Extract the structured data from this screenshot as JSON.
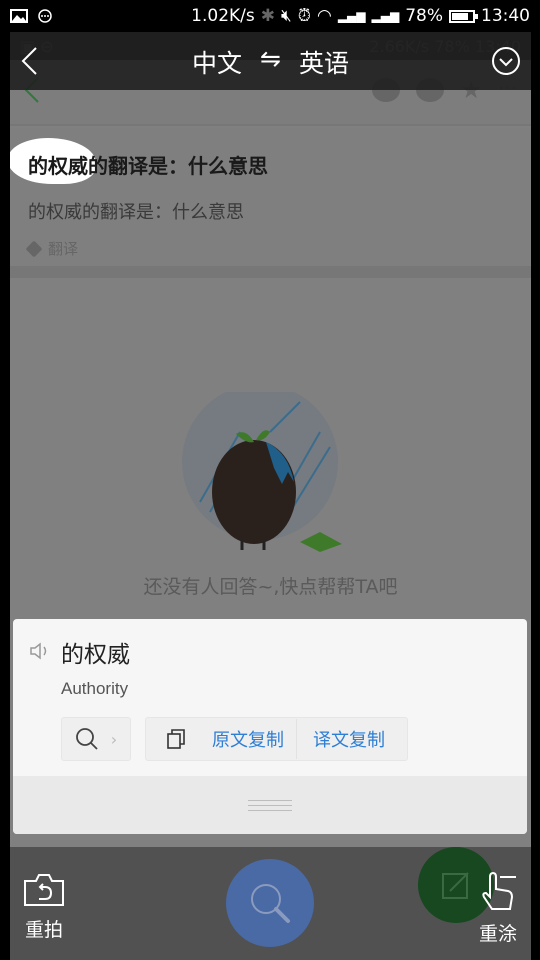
{
  "status_bar": {
    "net_speed": "1.02K/s",
    "battery": "78%",
    "battery_level": 0.78,
    "time": "13:40",
    "icons": [
      "image-icon",
      "message-icon",
      "bluetooth-icon",
      "mute-icon",
      "alarm-icon",
      "wifi-icon",
      "signal-icon",
      "signal-icon",
      "battery-icon"
    ]
  },
  "background_screen": {
    "status_net_speed": "2.66K/s",
    "status_battery": "78%",
    "status_time": "13:40",
    "question_title": "的权威的翻译是：什么意思",
    "question_body": "的权威的翻译是：什么意思",
    "tag": "翻译",
    "empty_text": "还没有人回答~,快点帮帮TA吧"
  },
  "topbar": {
    "source_lang": "中文",
    "swap_symbol": "⇋",
    "target_lang": "英语"
  },
  "translation": {
    "source_text": "的权威",
    "translated_text": "Authority",
    "copy_source_label": "原文复制",
    "copy_translation_label": "译文复制"
  },
  "bottombar": {
    "retake_label": "重拍",
    "redraw_label": "重涂"
  },
  "colors": {
    "link_blue": "#2d7ed4",
    "search_fab": "#4a6aa6",
    "edit_fab": "#17481f"
  }
}
